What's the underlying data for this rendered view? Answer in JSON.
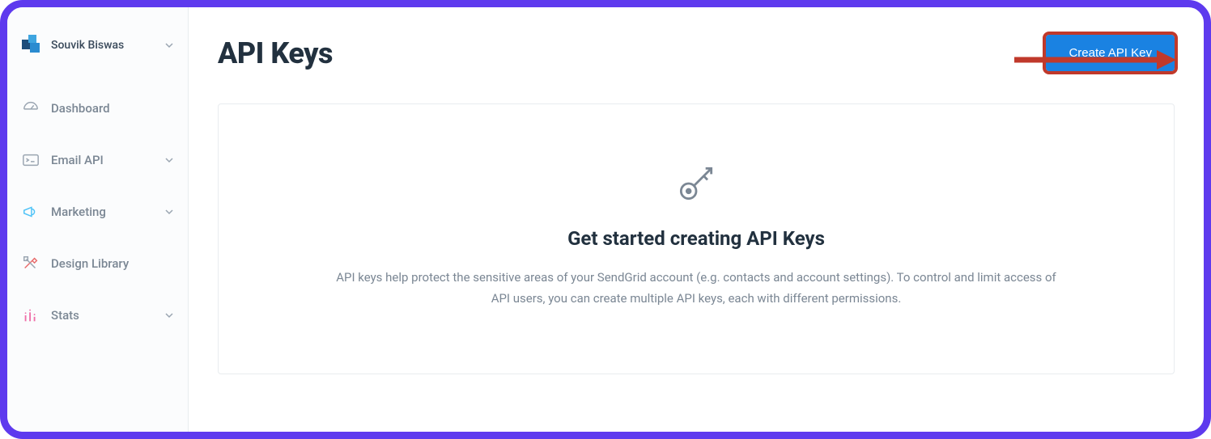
{
  "user": {
    "name": "Souvik Biswas"
  },
  "sidebar": {
    "items": [
      {
        "label": "Dashboard",
        "expandable": false
      },
      {
        "label": "Email API",
        "expandable": true
      },
      {
        "label": "Marketing",
        "expandable": true
      },
      {
        "label": "Design Library",
        "expandable": false
      },
      {
        "label": "Stats",
        "expandable": true
      }
    ]
  },
  "page": {
    "title": "API Keys",
    "create_button": "Create API Key"
  },
  "empty_state": {
    "title": "Get started creating API Keys",
    "description": "API keys help protect the sensitive areas of your SendGrid account (e.g. contacts and account settings). To control and limit access of API users, you can create multiple API keys, each with different permissions."
  },
  "colors": {
    "annotation": "#c0392b",
    "frame": "#5E3AEE",
    "primary_button": "#1a82e2"
  }
}
